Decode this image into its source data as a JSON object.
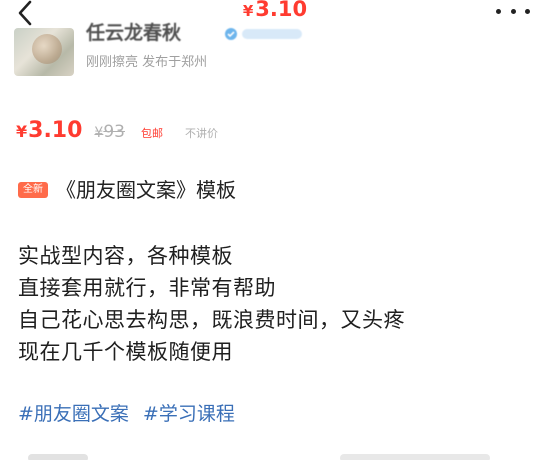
{
  "header": {
    "back_icon": "chevron-left-icon",
    "price_symbol": "¥",
    "price_value": "3.10",
    "more_icon": "more-dots-icon"
  },
  "seller": {
    "name": "任云龙春秋",
    "meta": "刚刚擦亮 发布于郑州"
  },
  "price": {
    "symbol": "¥",
    "current": "3.10",
    "original_symbol": "¥",
    "original": "93",
    "shipping": "包邮",
    "bargain": "不讲价",
    "accent_color": "#ff3b30"
  },
  "item": {
    "badge": "全新",
    "title": "《朋友圈文案》模板",
    "description_lines": [
      "实战型内容，各种模板",
      "直接套用就行，非常有帮助",
      "自己花心思去构思，既浪费时间，又头疼",
      "现在几千个模板随便用"
    ],
    "tags": [
      "#朋友圈文案",
      "#学习课程"
    ],
    "tag_color": "#3a6fb7"
  }
}
